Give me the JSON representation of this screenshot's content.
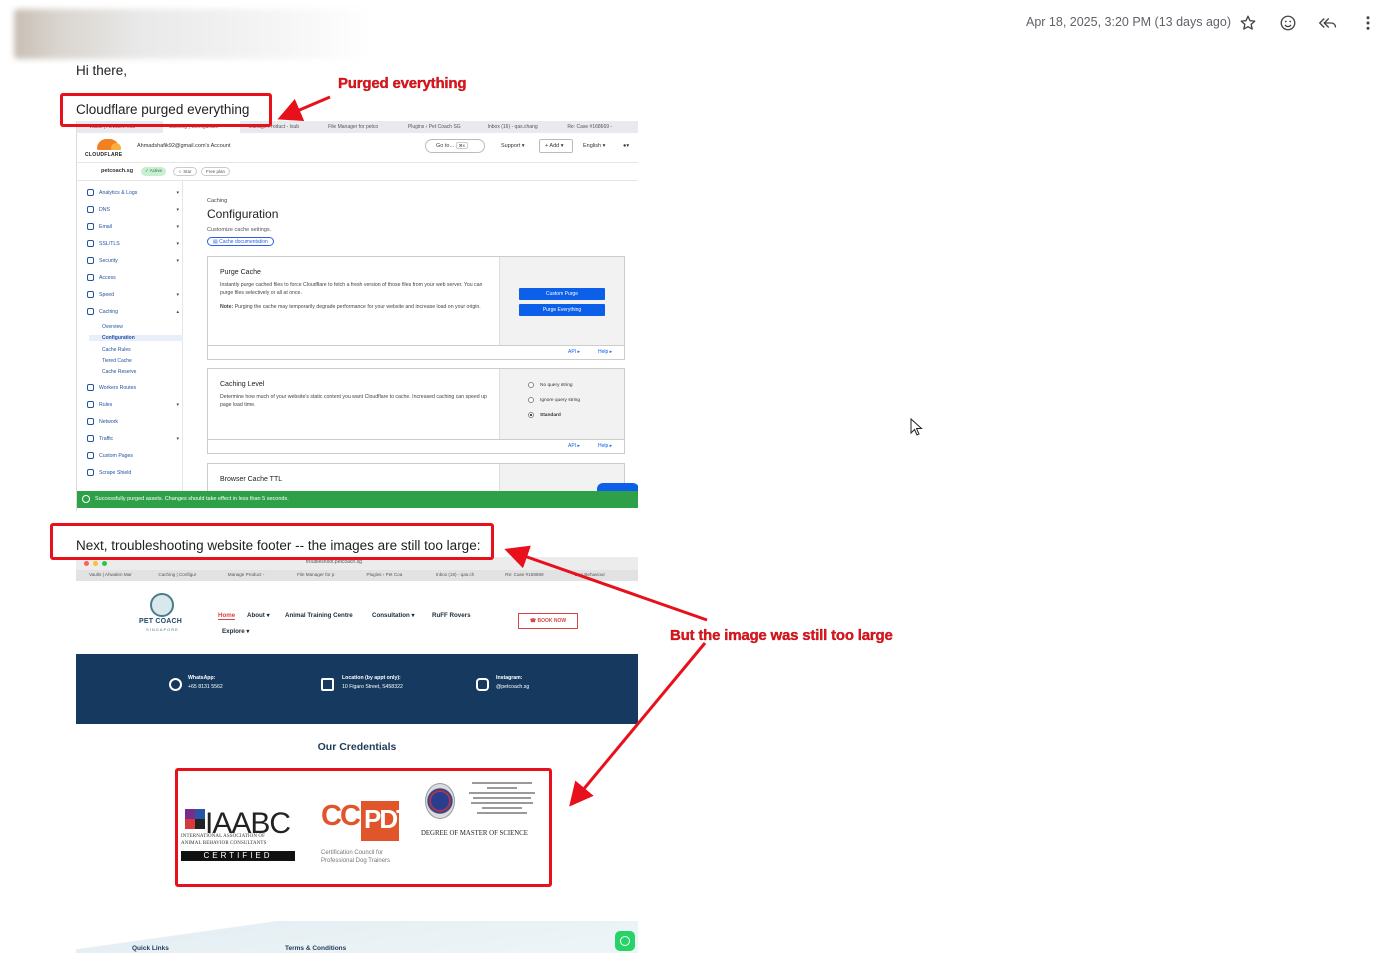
{
  "email": {
    "date": "Apr 18, 2025, 3:20 PM (13 days ago)",
    "greeting": "Hi there,",
    "line1": "Cloudflare purged everything",
    "line2": "Next, troubleshooting website footer -- the images are still too large:",
    "actions": [
      "star-icon",
      "emoji-icon",
      "reply-all-icon",
      "more-icon"
    ]
  },
  "annotations": {
    "purged": "Purged everything",
    "too_large": "But the image was still too large"
  },
  "cloudflare": {
    "tabs": [
      "Vaults | Ahwalen Mar",
      "Caching | Configuratio",
      "Manage Product - Isub",
      "File Manager for petco",
      "Plugins ‹ Pet Coach SG",
      "Inbox (16) - qas.chang",
      "Re: Case #168669 -"
    ],
    "logo_text": "CLOUDFLARE",
    "account": "Ahmadshafik92@gmail.com's Account",
    "goto": "Go to...",
    "goto_shortcut": "⌘K",
    "support": "Support",
    "add": "+ Add",
    "language": "English",
    "site": "petcoach.sg",
    "site_status": "Active",
    "site_star": "Star",
    "site_plan": "Free plan",
    "sidebar": [
      "Analytics & Logs",
      "DNS",
      "Email",
      "SSL/TLS",
      "Security",
      "Access",
      "Speed",
      "Caching",
      "Workers Routes",
      "Rules",
      "Network",
      "Traffic",
      "Custom Pages",
      "Scrape Shield"
    ],
    "caching_sub": [
      "Overview",
      "Configuration",
      "Cache Rules",
      "Tiered Cache",
      "Cache Reserve"
    ],
    "breadcrumb": "Caching",
    "page_title": "Configuration",
    "page_sub": "Customize cache settings.",
    "doc_link": "Cache documentation",
    "purge": {
      "title": "Purge Cache",
      "desc": "Instantly purge cached files to force Cloudflare to fetch a fresh version of those files from your web server. You can purge files selectively or all at once.",
      "note_label": "Note:",
      "note": "Purging the cache may temporarily degrade performance for your website and increase load on your origin.",
      "btn_custom": "Custom Purge",
      "btn_everything": "Purge Everything"
    },
    "api": "API",
    "help": "Help",
    "caching_level": {
      "title": "Caching Level",
      "desc": "Determine how much of your website's static content you want Cloudflare to cache. Increased caching can speed up page load time.",
      "options": [
        "No query string",
        "Ignore query string",
        "Standard"
      ],
      "selected": "Standard"
    },
    "browser_ttl": "Browser Cache TTL",
    "toast": "Successfully purged assets. Changes should take effect in less than 5 seconds."
  },
  "petcoach": {
    "url": "troubleshoot.petcoach.sg",
    "tabs": [
      "Vaults | Ahwalen Mar",
      "Caching | Configur",
      "Manage Product -",
      "File Manager for p",
      "Plugins ‹ Pet Coa",
      "Inbox (16) - qas.ch",
      "Re: Case #168669",
      "Dog Behaviour"
    ],
    "logo": "PET COACH",
    "logo_sub": "SINGAPORE",
    "nav": [
      "Home",
      "About",
      "Animal Training Centre",
      "Consultation",
      "RuFF Rovers",
      "Explore"
    ],
    "book": "BOOK NOW",
    "whatsapp_label": "WhatsApp:",
    "whatsapp": "+65 8131 5562",
    "location_label": "Location (by appt only):",
    "location": "10 Figaro Street, S458322",
    "instagram_label": "Instagram:",
    "instagram": "@petcoach.sg",
    "credentials_title": "Our Credentials",
    "iaabc": "IAABC",
    "iaabc_line1": "INTERNATIONAL ASSOCIATION OF",
    "iaabc_line2": "ANIMAL BEHAVIOR CONSULTANTS",
    "iaabc_cert": "CERTIFIED",
    "ccpdt": "CCPDT",
    "ccpdt_line1": "Certification Council for",
    "ccpdt_line2": "Professional Dog Trainers",
    "degree": "DEGREE OF MASTER OF SCIENCE",
    "footer_links": [
      "Quick Links",
      "Terms & Conditions"
    ]
  },
  "colors": {
    "annotation_red": "#e8101a",
    "cf_blue": "#0c5fe8",
    "toast_green": "#2ea148",
    "band_navy": "#163a5f"
  }
}
